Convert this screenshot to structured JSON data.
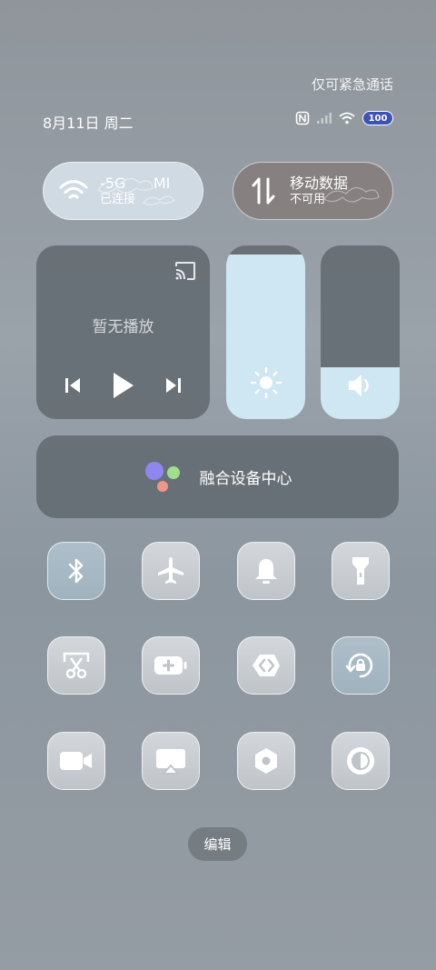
{
  "status": {
    "emergency_text": "仅可紧急通话",
    "date_text": "8月11日 周二",
    "battery_level": "100",
    "icons": [
      "nfc-icon",
      "signal-icon",
      "wifi-icon",
      "battery-icon"
    ]
  },
  "wifi_tile": {
    "name": "-5G",
    "extra": "MI",
    "status": "已连接"
  },
  "data_tile": {
    "name": "移动数据",
    "status": "不可用"
  },
  "media": {
    "no_playback": "暂无播放"
  },
  "sliders": {
    "brightness_level": 0.95,
    "volume_level": 0.3
  },
  "fusion": {
    "label": "融合设备中心"
  },
  "toggles": [
    {
      "icon": "bluetooth-icon",
      "active": true
    },
    {
      "icon": "airplane-icon",
      "active": false
    },
    {
      "icon": "bell-icon",
      "active": false
    },
    {
      "icon": "flashlight-icon",
      "active": false
    },
    {
      "icon": "screenshot-icon",
      "active": false
    },
    {
      "icon": "battery-saver-icon",
      "active": false
    },
    {
      "icon": "direct-connect-icon",
      "active": false
    },
    {
      "icon": "rotation-lock-icon",
      "active": true
    },
    {
      "icon": "video-icon",
      "active": false
    },
    {
      "icon": "screen-cast-icon",
      "active": false
    },
    {
      "icon": "settings-hexagon-icon",
      "active": false
    },
    {
      "icon": "dark-mode-icon",
      "active": false
    }
  ],
  "edit_label": "编辑",
  "colors": {
    "slider_fill": "#cfe6f3",
    "battery_fill": "#3c53b5",
    "panel": "#646b72"
  }
}
